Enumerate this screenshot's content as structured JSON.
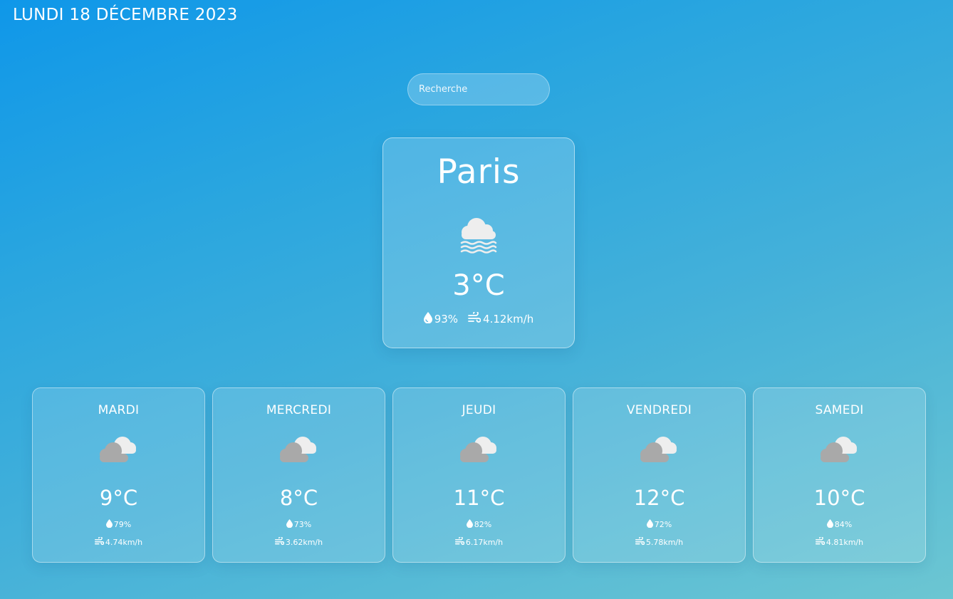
{
  "header": {
    "date": "LUNDI 18 DÉCEMBRE 2023"
  },
  "search": {
    "placeholder": "Recherche",
    "value": ""
  },
  "current": {
    "city": "Paris",
    "icon": "fog-icon",
    "temperature": "3°C",
    "humidity": "93%",
    "wind": "4.12km/h"
  },
  "forecast": [
    {
      "day": "MARDI",
      "icon": "cloud-icon",
      "temperature": "9°C",
      "humidity": "79%",
      "wind": "4.74km/h"
    },
    {
      "day": "MERCREDI",
      "icon": "cloud-icon",
      "temperature": "8°C",
      "humidity": "73%",
      "wind": "3.62km/h"
    },
    {
      "day": "JEUDI",
      "icon": "cloud-icon",
      "temperature": "11°C",
      "humidity": "82%",
      "wind": "6.17km/h"
    },
    {
      "day": "VENDREDI",
      "icon": "cloud-icon",
      "temperature": "12°C",
      "humidity": "72%",
      "wind": "5.78km/h"
    },
    {
      "day": "SAMEDI",
      "icon": "cloud-icon",
      "temperature": "10°C",
      "humidity": "84%",
      "wind": "4.81km/h"
    }
  ],
  "colors": {
    "background_top": "#0f97e9",
    "background_bottom": "#6cc6d2",
    "text": "#ffffff",
    "cloud_light": "#eeeeee",
    "cloud_dark": "#a9a9a9"
  }
}
